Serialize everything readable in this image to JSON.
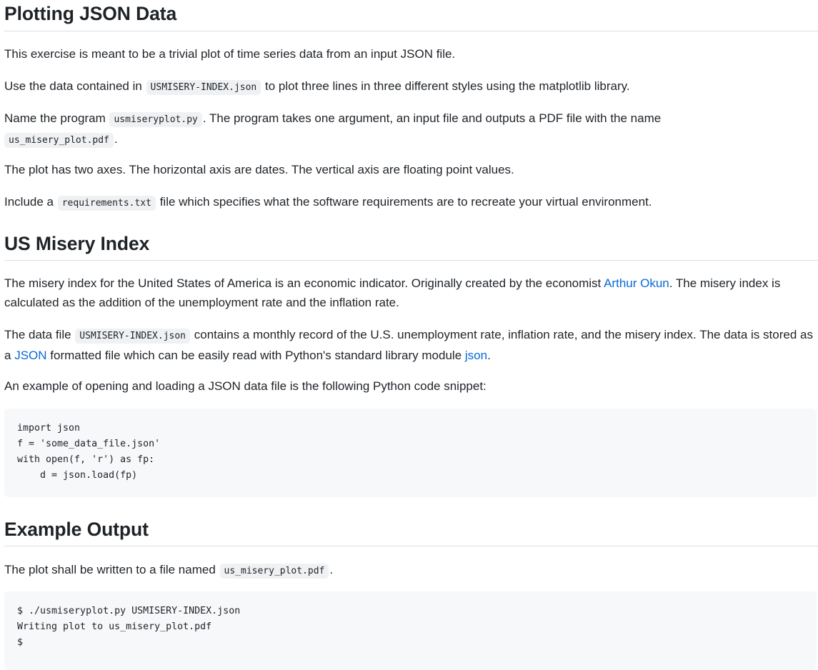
{
  "section1": {
    "heading": "Plotting JSON Data",
    "p1": "This exercise is meant to be a trivial plot of time series data from an input JSON file.",
    "p2": {
      "before": "Use the data contained in",
      "code": "USMISERY-INDEX.json",
      "after": "to plot three lines in three different styles using the matplotlib library."
    },
    "p3": {
      "before": "Name the program",
      "code1": "usmiseryplot.py",
      "middle": ". The program takes one argument, an input file and outputs a PDF file with the name",
      "code2": "us_misery_plot.pdf",
      "end": "."
    },
    "p4": "The plot has two axes. The horizontal axis are dates. The vertical axis are floating point values.",
    "p5": {
      "before": "Include a",
      "code": "requirements.txt",
      "after": "file which specifies what the software requirements are to recreate your virtual environment."
    }
  },
  "section2": {
    "heading": "US Misery Index",
    "p1": {
      "before": "The misery index for the United States of America is an economic indicator. Originally created by the economist",
      "link": "Arthur Okun",
      "after": ". The misery index is calculated as the addition of the unemployment rate and the inflation rate."
    },
    "p2": {
      "before": "The data file",
      "code": "USMISERY-INDEX.json",
      "middle": "contains a monthly record of the U.S. unemployment rate, inflation rate, and the misery index. The data is stored as a",
      "link1": "JSON",
      "middle2": "formatted file which can be easily read with Python's standard library module",
      "link2": "json",
      "end": "."
    },
    "p3": "An example of opening and loading a JSON data file is the following Python code snippet:",
    "code_lines": [
      "import json",
      "f = 'some_data_file.json'",
      "with open(f, 'r') as fp:",
      "    d = json.load(fp)"
    ]
  },
  "section3": {
    "heading": "Example Output",
    "p1": {
      "before": "The plot shall be written to a file named",
      "code": "us_misery_plot.pdf",
      "end": "."
    },
    "code_lines": [
      "$ ./usmiseryplot.py USMISERY-INDEX.json",
      "Writing plot to us_misery_plot.pdf",
      "$"
    ]
  },
  "colors": {
    "link": "#0969da",
    "text": "#1f2328",
    "code_bg": "#f6f8fa",
    "inline_code_bg": "#eff1f3",
    "rule": "#d8dee4"
  }
}
